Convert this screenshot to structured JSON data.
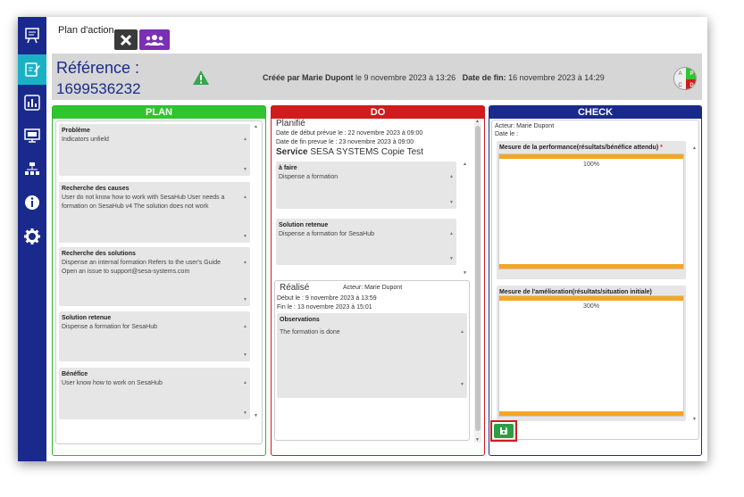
{
  "header": {
    "title": "Plan d'action",
    "reference_label": "Référence :",
    "reference_number": "1699536232",
    "created_by_label": "Créée par Marie Dupont",
    "created_at": " le 9 novembre 2023 à 13:26",
    "end_date_label": "Date de fin:",
    "end_date": " 16 novembre 2023 à 14:29",
    "pdca": {
      "p": "P",
      "d": "D",
      "a": "A",
      "c": "C"
    }
  },
  "plan": {
    "title": "PLAN",
    "fields": [
      {
        "label": "Problème",
        "value": "Indicators unfield"
      },
      {
        "label": "Recherche des causes",
        "value": "User do not know how to work with SesaHub User needs a formation on SesaHub v4 The solution does not work"
      },
      {
        "label": "Recherche des solutions",
        "value": "Dispense an internal formation Refers to the user's Guide Open an issue to support@sesa-systems.com"
      },
      {
        "label": "Solution retenue",
        "value": "Dispense a formation for SesaHub"
      },
      {
        "label": "Bénéfice",
        "value": "User know how to work on SesaHub"
      }
    ]
  },
  "do": {
    "title": "DO",
    "planned": {
      "heading": "Planifié",
      "start": "Date de début prévue le : 22 novembre 2023 à 09:00",
      "end": "Date de fin prevue le : 23 novembre 2023 à 09:00",
      "service_label": "Service",
      "service_value": " SESA SYSTEMS Copie Test",
      "todo_label": "à faire",
      "todo_value": "Dispense a formation",
      "solution_label": "Solution retenue",
      "solution_value": "Dispense a formation for SesaHub"
    },
    "done": {
      "heading": "Réalisé",
      "actor": "Acteur: Marie Dupont",
      "start": "Début le : 9 novembre 2023 à 13:59",
      "end": "Fin le : 13 novembre 2023 à 15:01",
      "observations_label": "Observations",
      "observations_value": "The formation is done"
    }
  },
  "check": {
    "title": "CHECK",
    "actor": "Acteur: Marie Dupont",
    "date": "Date le :",
    "performance_label": "Mesure de la performance(résultats/bénéfice attendu)",
    "required_mark": "*",
    "performance_value": "100%",
    "improvement_label": "Mesure de l'amélioration(résultats/situation initiale)",
    "improvement_value": "300%"
  },
  "colors": {
    "nav": "#1a2a8c",
    "nav_active": "#1bb1c4",
    "plan": "#2fc52f",
    "do": "#d01c1c",
    "check": "#1a2a8c",
    "bar": "#f5a623",
    "save": "#2e9e45"
  }
}
